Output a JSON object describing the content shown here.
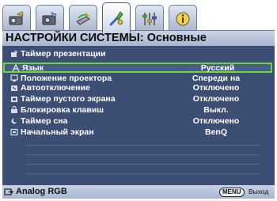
{
  "tabs": [
    {
      "icon": "display-icon",
      "active": false
    },
    {
      "icon": "picture-settings-icon",
      "active": false
    },
    {
      "icon": "source-icon",
      "active": false
    },
    {
      "icon": "system-setup-icon",
      "active": true
    },
    {
      "icon": "advanced-settings-icon",
      "active": false
    },
    {
      "icon": "information-icon",
      "active": false
    }
  ],
  "header": {
    "title": "НАСТРОЙКИ СИСТЕМЫ: Основные"
  },
  "menu": {
    "items": [
      {
        "label": "Таймер презентации",
        "value": "",
        "icon": "timer-icon"
      },
      {
        "label": "Язык",
        "value": "Русский",
        "icon": "language-icon",
        "selected": true
      },
      {
        "label": "Положение проектора",
        "value": "Спереди на",
        "icon": "projector-position-icon"
      },
      {
        "label": "Автоотключение",
        "value": "Отключено",
        "icon": "auto-off-icon"
      },
      {
        "label": "Таймер пустого экрана",
        "value": "Отключено",
        "icon": "blank-timer-icon"
      },
      {
        "label": "Блокировка клавиш",
        "value": "Выкл.",
        "icon": "key-lock-icon"
      },
      {
        "label": "Таймер сна",
        "value": "Отключено",
        "icon": "sleep-timer-icon"
      },
      {
        "label": "Начальный экран",
        "value": "BenQ",
        "icon": "splash-screen-icon"
      }
    ]
  },
  "footer": {
    "source": "Analog RGB",
    "menu_key": "MENU",
    "exit_label": "Выход"
  },
  "colors": {
    "selection": "#6bd93b",
    "panel": "#3c4e73",
    "header": "#b7c2d8"
  }
}
